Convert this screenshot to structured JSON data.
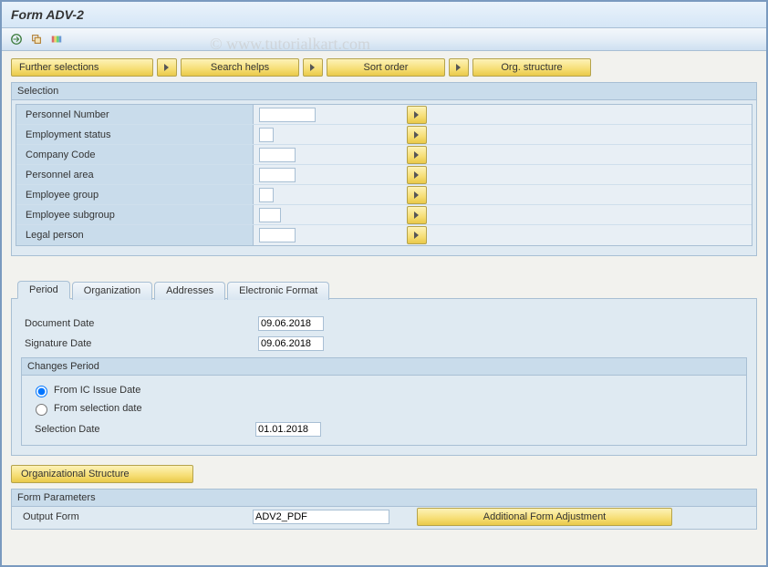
{
  "title": "Form ADV-2",
  "watermark": "© www.tutorialkart.com",
  "toolbar_buttons": {
    "further_selections": "Further selections",
    "search_helps": "Search helps",
    "sort_order": "Sort order",
    "org_structure": "Org. structure"
  },
  "selection": {
    "title": "Selection",
    "fields": {
      "personnel_number": "Personnel Number",
      "employment_status": "Employment status",
      "company_code": "Company Code",
      "personnel_area": "Personnel area",
      "employee_group": "Employee group",
      "employee_subgroup": "Employee subgroup",
      "legal_person": "Legal person"
    }
  },
  "tabs": {
    "period": "Period",
    "organization": "Organization",
    "addresses": "Addresses",
    "electronic_format": "Electronic Format"
  },
  "period_tab": {
    "document_date_label": "Document Date",
    "document_date_value": "09.06.2018",
    "signature_date_label": "Signature Date",
    "signature_date_value": "09.06.2018",
    "changes_period_title": "Changes Period",
    "from_ic_issue": "From IC Issue Date",
    "from_selection": "From selection date",
    "selection_date_label": "Selection Date",
    "selection_date_value": "01.01.2018"
  },
  "org_structure_btn": "Organizational Structure",
  "form_params": {
    "title": "Form Parameters",
    "output_form_label": "Output Form",
    "output_form_value": "ADV2_PDF",
    "additional_btn": "Additional Form Adjustment"
  }
}
